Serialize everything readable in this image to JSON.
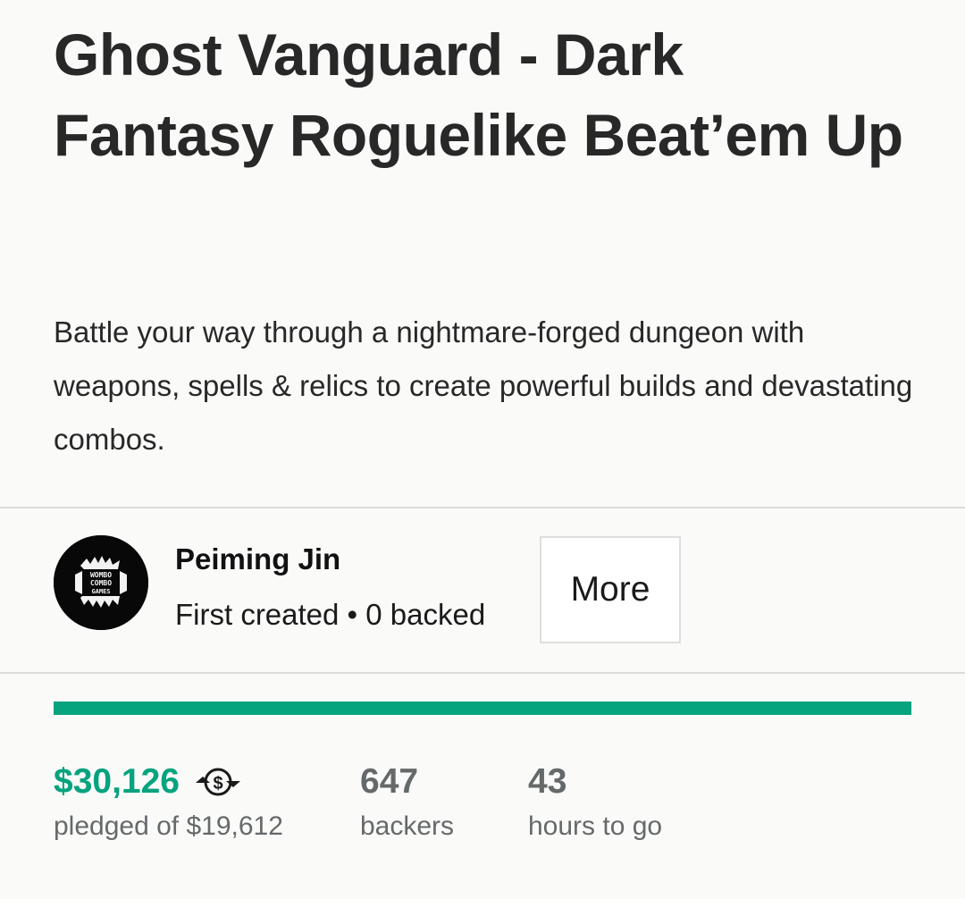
{
  "project": {
    "title": "Ghost Vanguard - Dark Fantasy Roguelike Beat’em Up",
    "blurb": "Battle your way through a nightmare-forged dungeon with weapons, spells & relics to create powerful builds and devastating combos."
  },
  "creator": {
    "name": "Peiming Jin",
    "stats": "First created • 0 backed",
    "avatar_text": "WOMBO COMBO GAMES",
    "more_label": "More"
  },
  "funding": {
    "progress_fraction": 1.0,
    "pledged": "$30,126",
    "pledged_label": "pledged of $19,612",
    "backers": "647",
    "backers_label": "backers",
    "time_left": "43",
    "time_left_label": "hours to go",
    "currency_icon": "currency-conversion-icon"
  },
  "colors": {
    "accent": "#05a37e",
    "text": "#282828",
    "muted": "#656969",
    "background": "#fafaf9"
  }
}
